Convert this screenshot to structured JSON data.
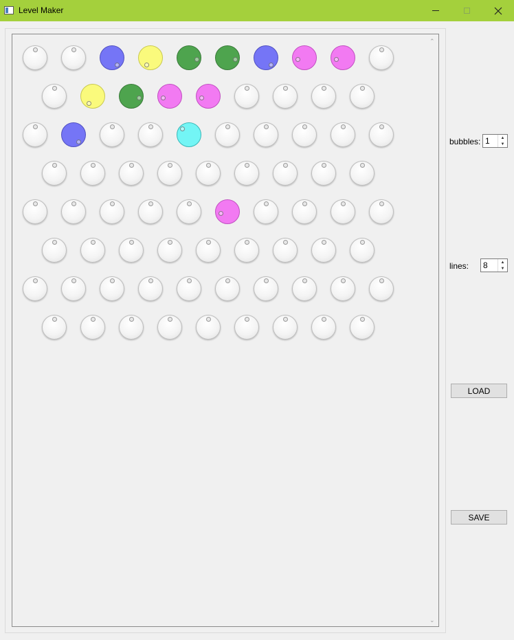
{
  "window": {
    "title": "Level Maker"
  },
  "controls": {
    "bubbles_label": "bubbles:",
    "bubbles_value": "1",
    "lines_label": "lines:",
    "lines_value": "8",
    "load_label": "LOAD",
    "save_label": "SAVE"
  },
  "colors": {
    "titlebar": "#a4d03c",
    "blue": "#7575f6",
    "yellow": "#fafa7c",
    "green": "#4ea44e",
    "pink": "#f27af2",
    "cyan": "#73f5f5",
    "empty": "#f2f2f2"
  },
  "icons": [
    "app-icon",
    "minimize-icon",
    "maximize-icon",
    "close-icon",
    "scroll-up-arrow-icon",
    "scroll-down-arrow-icon",
    "spin-up-arrow-icon",
    "spin-down-arrow-icon"
  ],
  "grid": {
    "rows": [
      [
        "empty",
        "empty",
        "blue",
        "yellow",
        "green",
        "green",
        "blue",
        "pink",
        "pink",
        "empty"
      ],
      [
        "empty",
        "yellow",
        "green",
        "pink",
        "pink",
        "empty",
        "empty",
        "empty",
        "empty"
      ],
      [
        "empty",
        "blue",
        "empty",
        "empty",
        "cyan",
        "empty",
        "empty",
        "empty",
        "empty",
        "empty"
      ],
      [
        "empty",
        "empty",
        "empty",
        "empty",
        "empty",
        "empty",
        "empty",
        "empty",
        "empty"
      ],
      [
        "empty",
        "empty",
        "empty",
        "empty",
        "empty",
        "pink",
        "empty",
        "empty",
        "empty",
        "empty"
      ],
      [
        "empty",
        "empty",
        "empty",
        "empty",
        "empty",
        "empty",
        "empty",
        "empty",
        "empty"
      ],
      [
        "empty",
        "empty",
        "empty",
        "empty",
        "empty",
        "empty",
        "empty",
        "empty",
        "empty",
        "empty"
      ],
      [
        "empty",
        "empty",
        "empty",
        "empty",
        "empty",
        "empty",
        "empty",
        "empty",
        "empty"
      ]
    ]
  }
}
